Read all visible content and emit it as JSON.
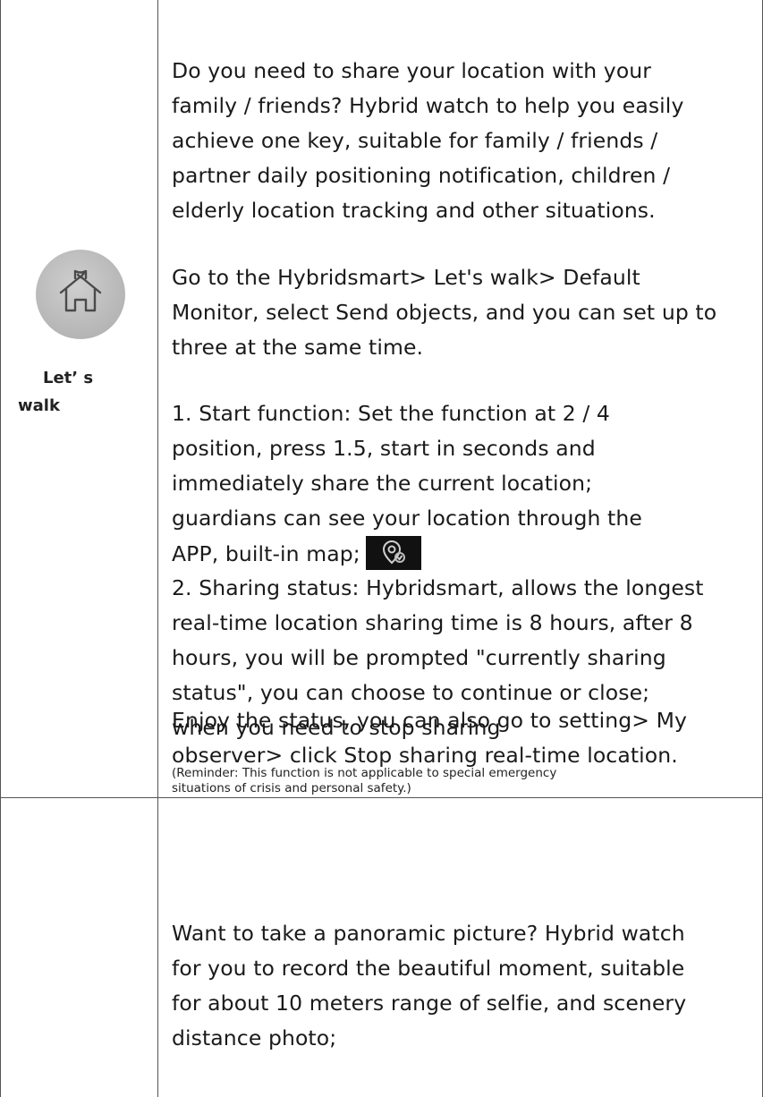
{
  "row1": {
    "feature_label_line1": "Let’ s",
    "feature_label_line2": "walk",
    "icon": "home-shield-icon",
    "paragraph1": [
      " Do you need to share your location with your",
      "family / friends? Hybrid watch to help you easily",
      "achieve one key, suitable for family / friends /",
      "partner daily positioning notification, children /",
      "elderly location tracking and other situations."
    ],
    "paragraph2": [
      "Go to the Hybridsmart> Let's walk> Default",
      "Monitor, select Send objects, and you can set up to",
      "three at the same time."
    ],
    "step1": [
      "1. Start function: Set the function at 2 / 4",
      "position, press 1.5, start in seconds and",
      "immediately share the current location;",
      "guardians can see your location through the",
      "APP, built-in map;"
    ],
    "step1_icon": "location-pin-icon",
    "step2": [
      "2. Sharing status: Hybridsmart, allows the longest",
      "real-time location sharing time is 8 hours, after 8",
      "hours, you will be prompted \"currently sharing",
      "status\", you can choose to continue or close;",
      "when you need to stop sharing"
    ],
    "enjoy": [
      "Enjoy the status, you can also go to setting> My",
      "observer> click Stop sharing real-time location."
    ],
    "reminder": [
      " (Reminder: This function is not applicable to special emergency",
      "situations of crisis and personal safety.)"
    ]
  },
  "row2": {
    "paragraph1": [
      "Want to take a panoramic picture? Hybrid watch",
      "for you to record the beautiful moment, suitable",
      "for about 10 meters range of selfie, and scenery",
      "distance photo;"
    ]
  }
}
